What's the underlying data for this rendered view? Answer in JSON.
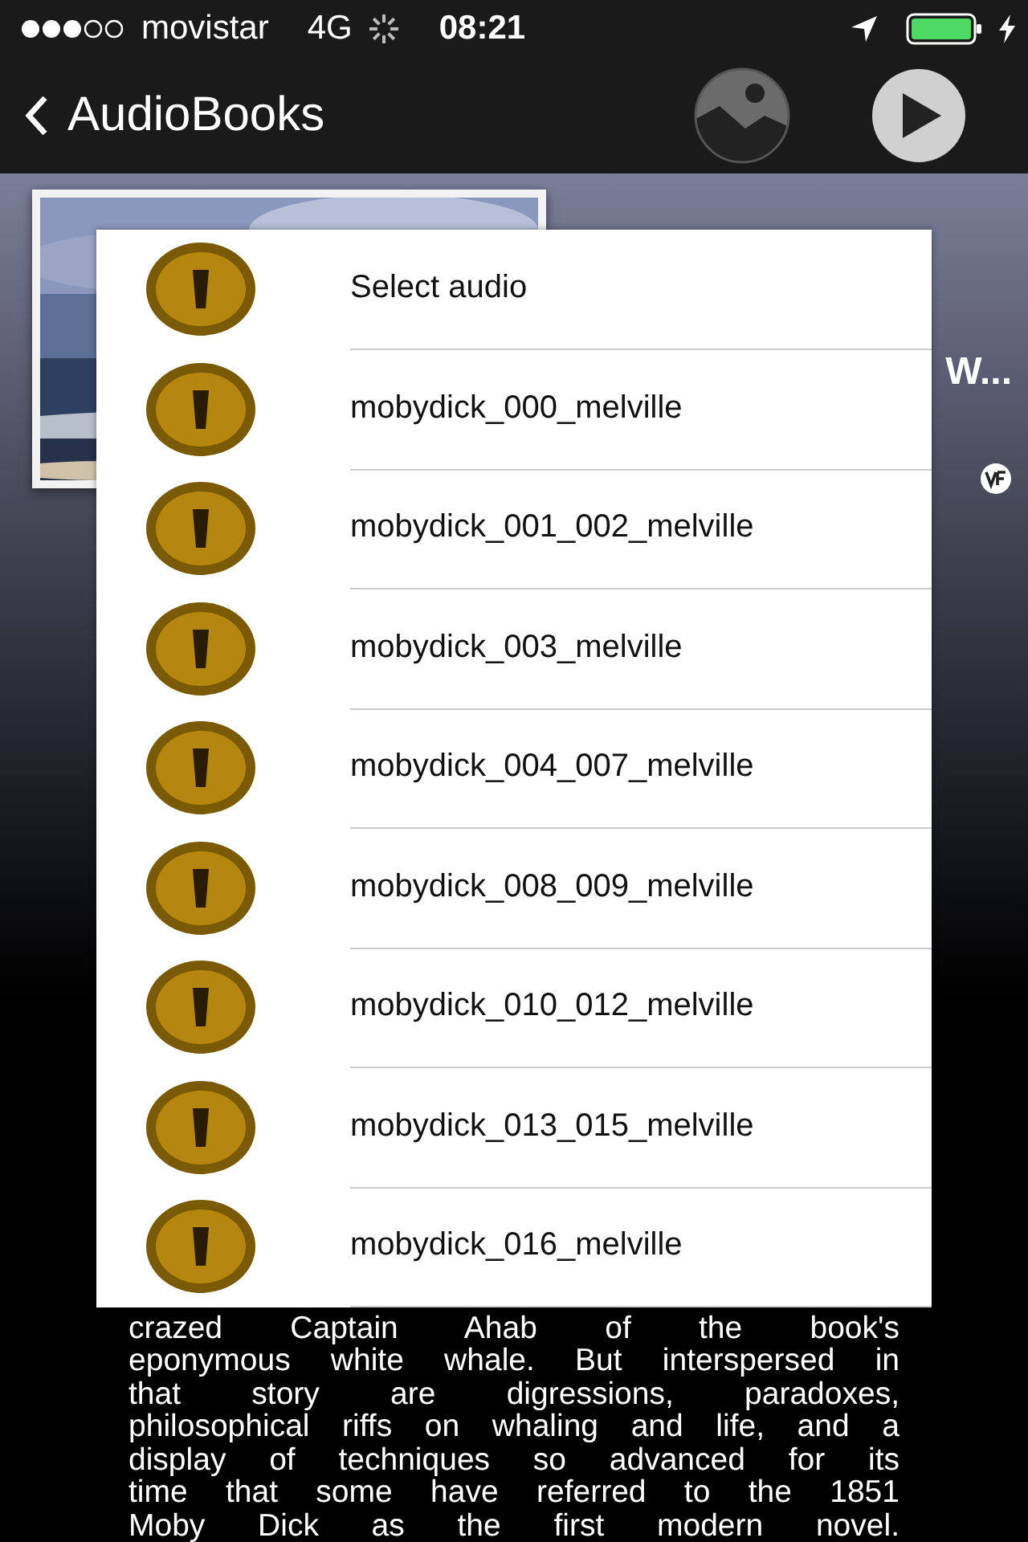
{
  "status_bar": {
    "carrier": "movistar",
    "network": "4G",
    "time": "08:21"
  },
  "nav_bar": {
    "back_label": "AudioBooks"
  },
  "book": {
    "title": "W...",
    "description_lines": [
      "crazed Captain Ahab of the book's",
      "eponymous white whale. But interspersed in",
      "that story are digressions, paradoxes,",
      "philosophical riffs on whaling and life, and a",
      "display of techniques so advanced for its",
      "time that some have referred to the 1851",
      "Moby Dick as the first modern novel."
    ]
  },
  "popup": {
    "items": [
      {
        "label": "Select audio"
      },
      {
        "label": "mobydick_000_melville"
      },
      {
        "label": "mobydick_001_002_melville"
      },
      {
        "label": "mobydick_003_melville"
      },
      {
        "label": "mobydick_004_007_melville"
      },
      {
        "label": "mobydick_008_009_melville"
      },
      {
        "label": "mobydick_010_012_melville"
      },
      {
        "label": "mobydick_013_015_melville"
      },
      {
        "label": "mobydick_016_melville"
      }
    ]
  }
}
